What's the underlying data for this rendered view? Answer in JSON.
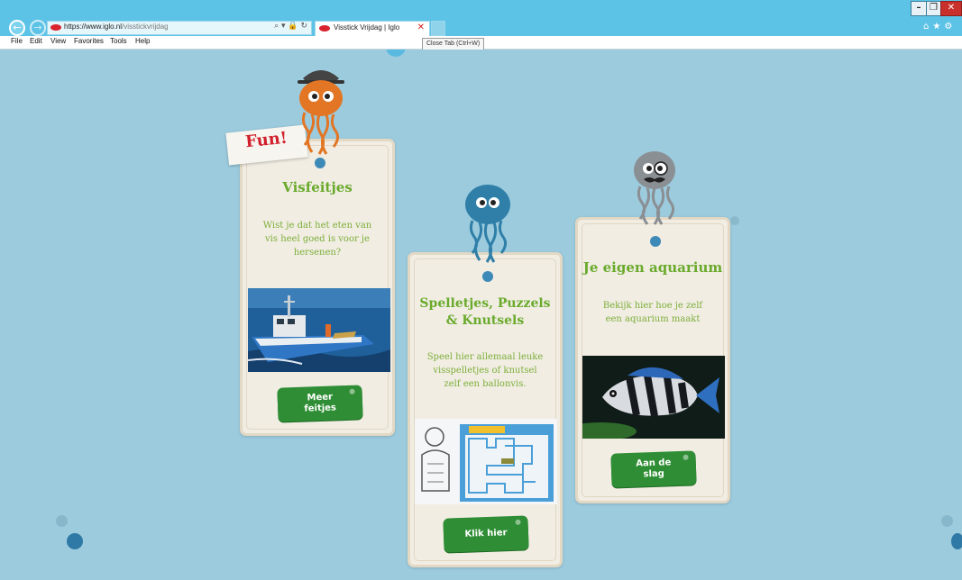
{
  "browser": {
    "url_host": "https://www.iglo.nl",
    "url_path": "/visstickvrijdag",
    "address_icons": "⌕ ▾ 🔒 ↻",
    "tab_title": "Visstick Vrijdag | Iglo",
    "tooltip": "Close Tab (Ctrl+W)",
    "menu": [
      "File",
      "Edit",
      "View",
      "Favorites",
      "Tools",
      "Help"
    ]
  },
  "page": {
    "fun_label": "Fun!",
    "cards": [
      {
        "title": "Visfeitjes",
        "description": "Wist je dat het eten van vis heel goed is voor je hersenen?",
        "button": "Meer feitjes"
      },
      {
        "title": "Spelletjes, Puzzels & Knutsels",
        "description": "Speel hier allemaal leuke visspelletjes of knutsel zelf een ballonvis.",
        "button": "Klik hier"
      },
      {
        "title": "Je eigen aquarium",
        "description": "Bekijk hier hoe je zelf een aquarium maakt",
        "button": "Aan de slag"
      }
    ]
  },
  "colors": {
    "background": "#9ccbde",
    "title_green": "#6aaa2c",
    "button_green": "#2f8e35",
    "fun_red": "#d11f2b",
    "chrome_blue": "#5dc3e6"
  }
}
